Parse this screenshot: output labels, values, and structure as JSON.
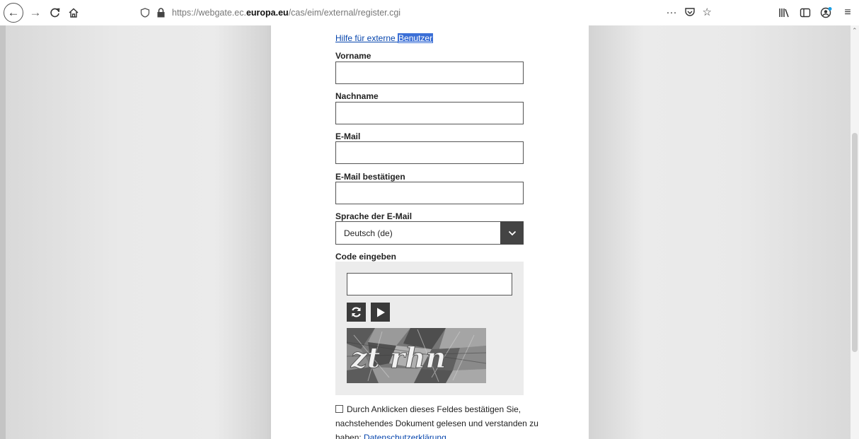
{
  "browser": {
    "url_prefix": "https://webgate.ec.",
    "url_domain": "europa.eu",
    "url_path": "/cas/eim/external/register.cgi",
    "more_label": "···"
  },
  "form": {
    "help_link_part1": "Hilfe für externe ",
    "help_link_part2": "Benutzer",
    "first_name_label": "Vorname",
    "last_name_label": "Nachname",
    "email_label": "E-Mail",
    "email_confirm_label": "E-Mail bestätigen",
    "language_label": "Sprache der E-Mail",
    "language_value": "Deutsch (de)",
    "code_label": "Code eingeben",
    "captcha_text": "zt rhn",
    "consent_text": "Durch Anklicken dieses Feldes bestätigen Sie, nachstehendes Dokument gelesen und verstanden zu haben: ",
    "privacy_link": "Datenschutzerklärung"
  },
  "colors": {
    "link": "#0645ad",
    "selection": "#3b6fd6",
    "dark_button": "#3a3a3a"
  }
}
